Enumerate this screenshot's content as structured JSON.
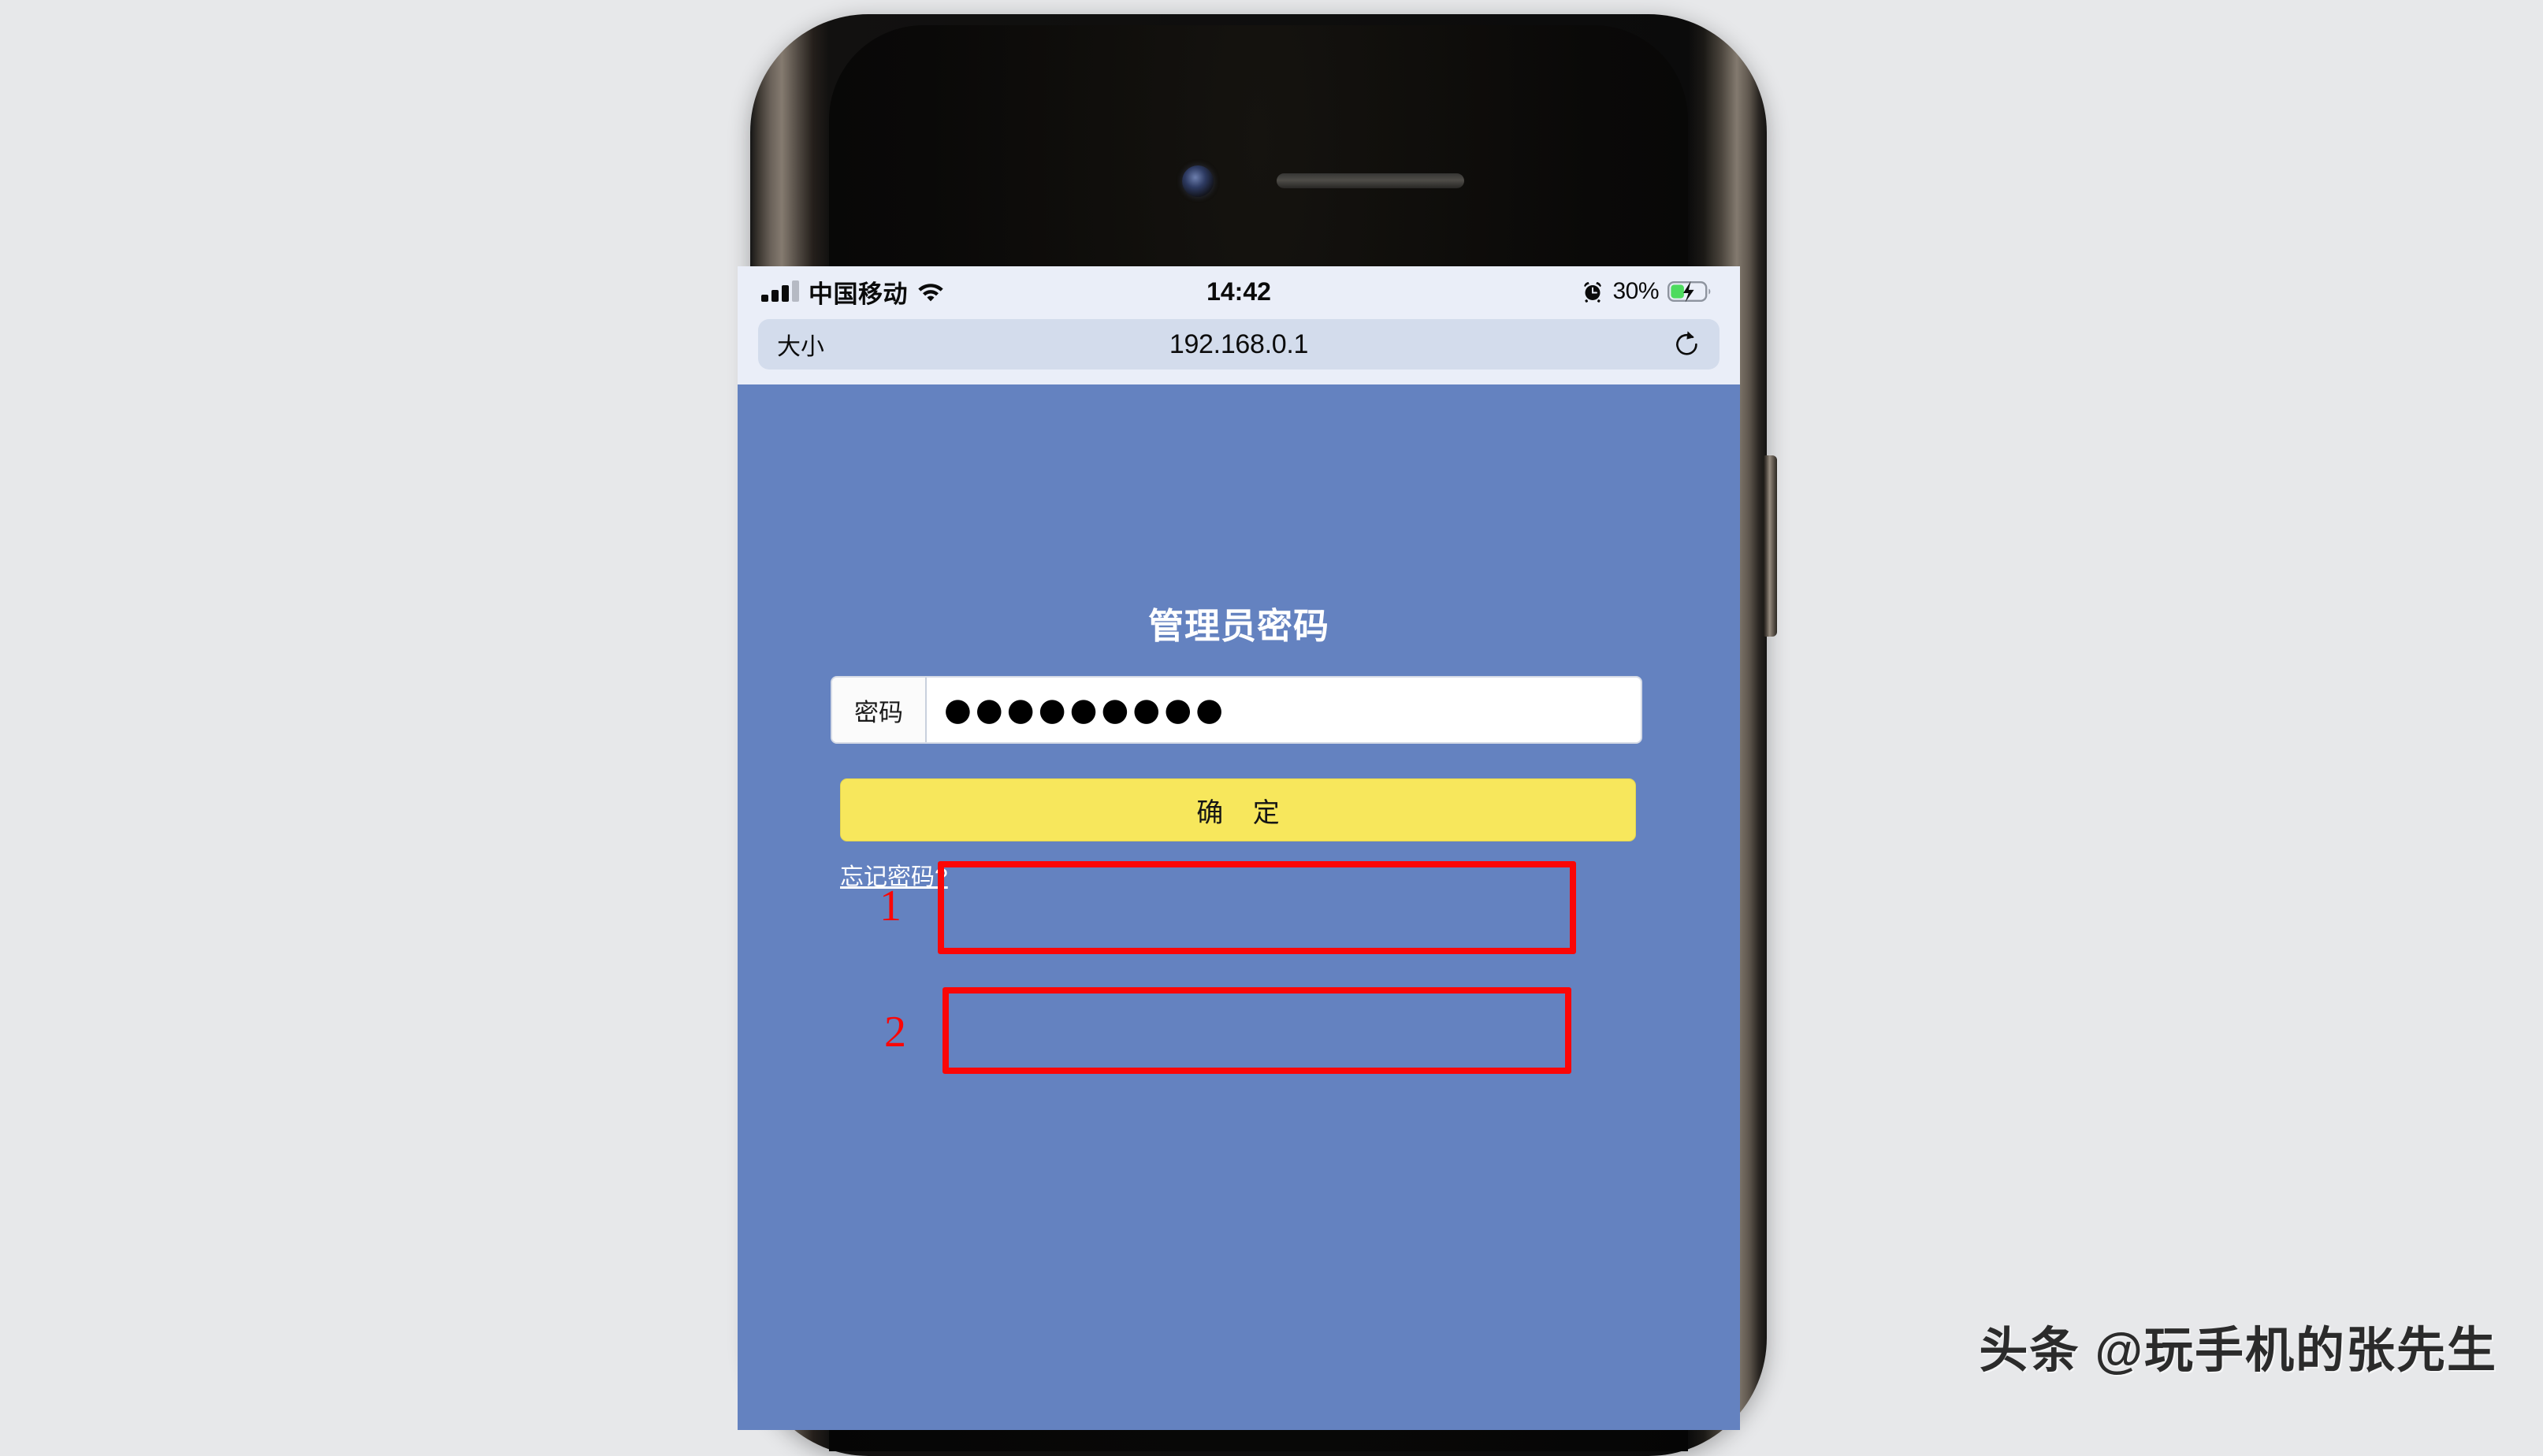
{
  "phone": {
    "hardware": {
      "front_camera": "front-camera",
      "earpiece": "earpiece-speaker",
      "buttons": [
        "mute-switch",
        "volume-up",
        "volume-down",
        "power-button"
      ]
    }
  },
  "status_bar": {
    "carrier": "中国移动",
    "signal_bars_filled": 3,
    "signal_bars_total": 4,
    "wifi_icon": "wifi-icon",
    "time": "14:42",
    "alarm_icon": "alarm-clock-icon",
    "battery_percent": "30%",
    "battery_icon": "battery-charging-icon",
    "battery_level": 30,
    "charging": true,
    "background_color": "#eaeef8"
  },
  "browser": {
    "text_size_label": "大小",
    "url": "192.168.0.1",
    "reload_icon": "reload-icon",
    "pill_color": "#d3dcec"
  },
  "page": {
    "background_color": "#6482c0",
    "title": "管理员密码",
    "password_field": {
      "prefix_label": "密码",
      "value": "●●●●●●●●●",
      "char_count": 9
    },
    "confirm_button": {
      "label": "确 定",
      "color": "#f7e75c",
      "text_color": "#151515"
    },
    "forgot_link": "忘记密码?"
  },
  "annotations": {
    "accent_color": "#fb0606",
    "step_1": "1",
    "step_2": "2"
  },
  "watermark": {
    "text": "头条 @玩手机的张先生"
  }
}
